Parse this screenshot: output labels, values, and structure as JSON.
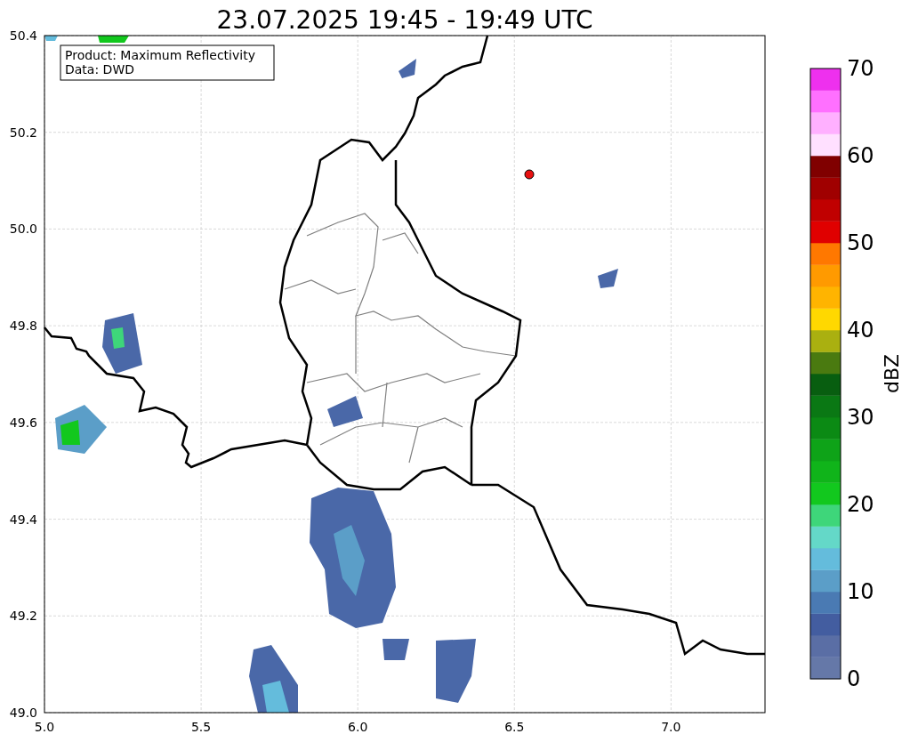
{
  "title": "23.07.2025 19:45 - 19:49 UTC",
  "map": {
    "info": [
      "Product: Maximum Reflectivity",
      "Data: DWD"
    ],
    "xticks": [
      "5.0",
      "5.5",
      "6.0",
      "6.5",
      "7.0"
    ],
    "yticks": [
      "50.4",
      "50.2",
      "50.0",
      "49.8",
      "49.6",
      "49.4",
      "49.2",
      "49.0"
    ]
  },
  "colorbar": {
    "label": "dBZ",
    "ticks": [
      "70",
      "60",
      "50",
      "40",
      "30",
      "20",
      "10",
      "0"
    ],
    "bins": [
      {
        "color": "#6578a8"
      },
      {
        "color": "#5a6ea5"
      },
      {
        "color": "#435da0"
      },
      {
        "color": "#4a7ab3"
      },
      {
        "color": "#5b9ec8"
      },
      {
        "color": "#64bcdc"
      },
      {
        "color": "#64d8c8"
      },
      {
        "color": "#3ed67a"
      },
      {
        "color": "#12c81e"
      },
      {
        "color": "#10b41a"
      },
      {
        "color": "#0ea318"
      },
      {
        "color": "#0b8a14"
      },
      {
        "color": "#0a7814"
      },
      {
        "color": "#085e10"
      },
      {
        "color": "#4a7a10"
      },
      {
        "color": "#aab010"
      },
      {
        "color": "#ffd800"
      },
      {
        "color": "#ffb400"
      },
      {
        "color": "#ff9a00"
      },
      {
        "color": "#ff7800"
      },
      {
        "color": "#e00000"
      },
      {
        "color": "#c00000"
      },
      {
        "color": "#a00000"
      },
      {
        "color": "#800000"
      },
      {
        "color": "#ffe0ff"
      },
      {
        "color": "#ffb0ff"
      },
      {
        "color": "#ff70ff"
      },
      {
        "color": "#ee30ee"
      }
    ]
  }
}
